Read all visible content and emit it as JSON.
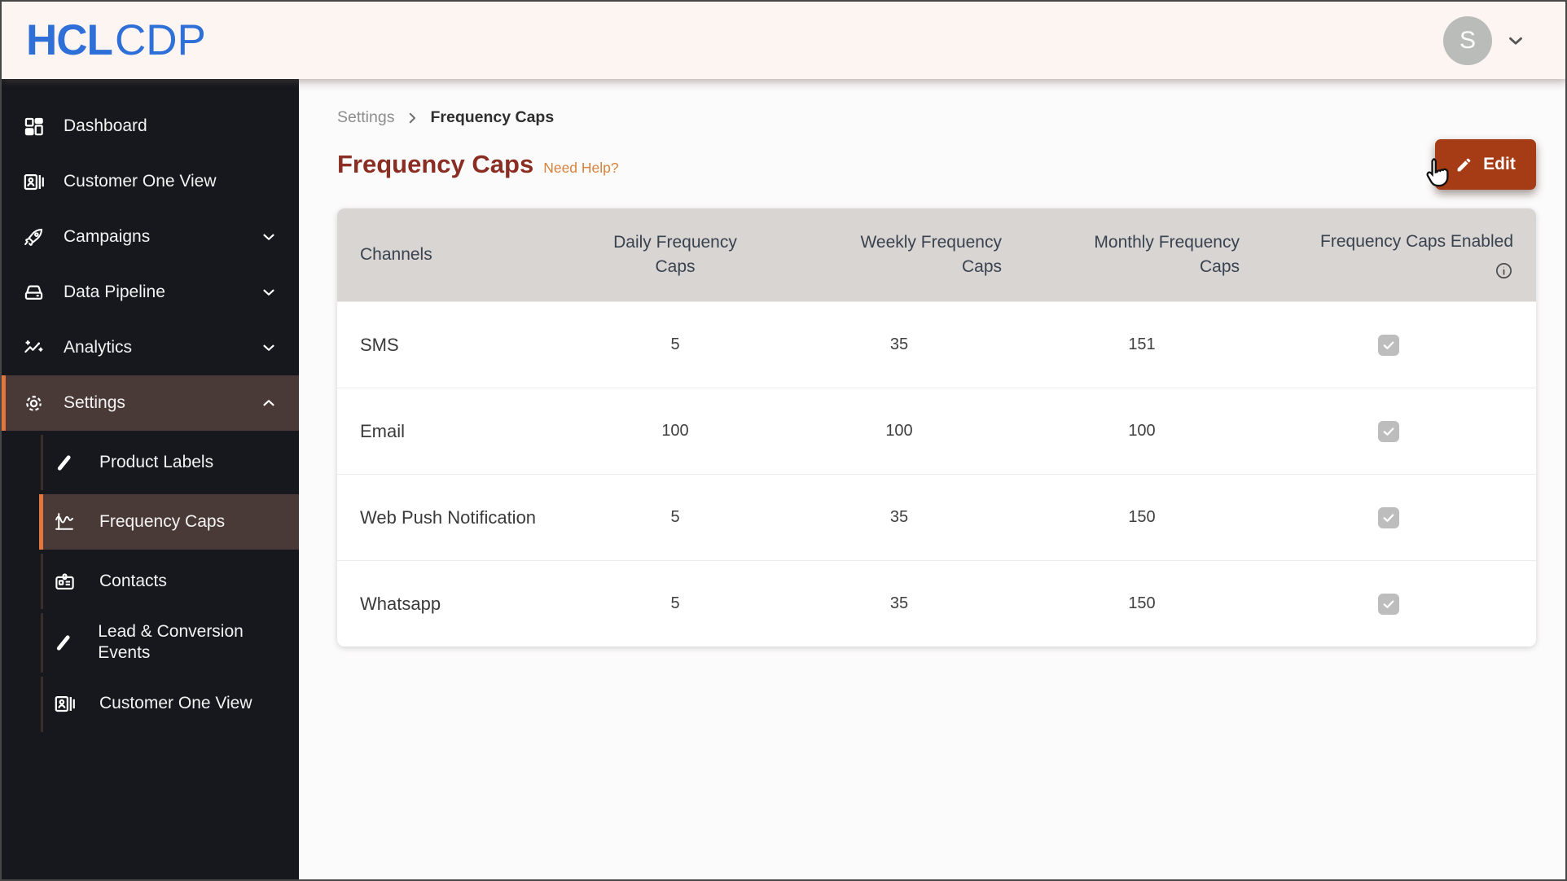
{
  "header": {
    "logo_bold": "HCL",
    "logo_light": "CDP",
    "avatar_initial": "S"
  },
  "sidebar": {
    "items": [
      {
        "label": "Dashboard",
        "icon": "dashboard"
      },
      {
        "label": "Customer One View",
        "icon": "id-card"
      },
      {
        "label": "Campaigns",
        "icon": "rocket",
        "chevron": "down"
      },
      {
        "label": "Data Pipeline",
        "icon": "drive",
        "chevron": "down"
      },
      {
        "label": "Analytics",
        "icon": "analytics",
        "chevron": "down"
      },
      {
        "label": "Settings",
        "icon": "gear",
        "chevron": "up",
        "active": true
      }
    ],
    "sub_items": [
      {
        "label": "Product Labels",
        "icon": "pencil"
      },
      {
        "label": "Frequency Caps",
        "icon": "waveform",
        "active": true
      },
      {
        "label": "Contacts",
        "icon": "badge"
      },
      {
        "label": "Lead & Conversion Events",
        "icon": "pencil"
      },
      {
        "label": "Customer One View",
        "icon": "id-card"
      }
    ]
  },
  "breadcrumb": {
    "parent": "Settings",
    "current": "Frequency Caps"
  },
  "page": {
    "title": "Frequency Caps",
    "help_link": "Need Help?",
    "edit_button": "Edit"
  },
  "table": {
    "columns": [
      "Channels",
      "Daily Frequency Caps",
      "Weekly Frequency Caps",
      "Monthly Frequency Caps",
      "Frequency Caps Enabled"
    ],
    "rows": [
      {
        "channel": "SMS",
        "daily": "5",
        "weekly": "35",
        "monthly": "151",
        "enabled": true
      },
      {
        "channel": "Email",
        "daily": "100",
        "weekly": "100",
        "monthly": "100",
        "enabled": true
      },
      {
        "channel": "Web Push Notification",
        "daily": "5",
        "weekly": "35",
        "monthly": "150",
        "enabled": true
      },
      {
        "channel": "Whatsapp",
        "daily": "5",
        "weekly": "35",
        "monthly": "150",
        "enabled": true
      }
    ]
  },
  "colors": {
    "logo_blue": "#2e6fd8",
    "topbar_bg": "#fdf5f2",
    "sidebar_bg": "#16181d",
    "active_item_bg": "#4a3a37",
    "accent_orange": "#e2763c",
    "title_maroon": "#8a2d22",
    "help_link": "#d6823c",
    "edit_button_bg": "#a63c16",
    "table_header_bg": "#d9d5d3",
    "checkbox_gray": "#bdbdbd"
  }
}
